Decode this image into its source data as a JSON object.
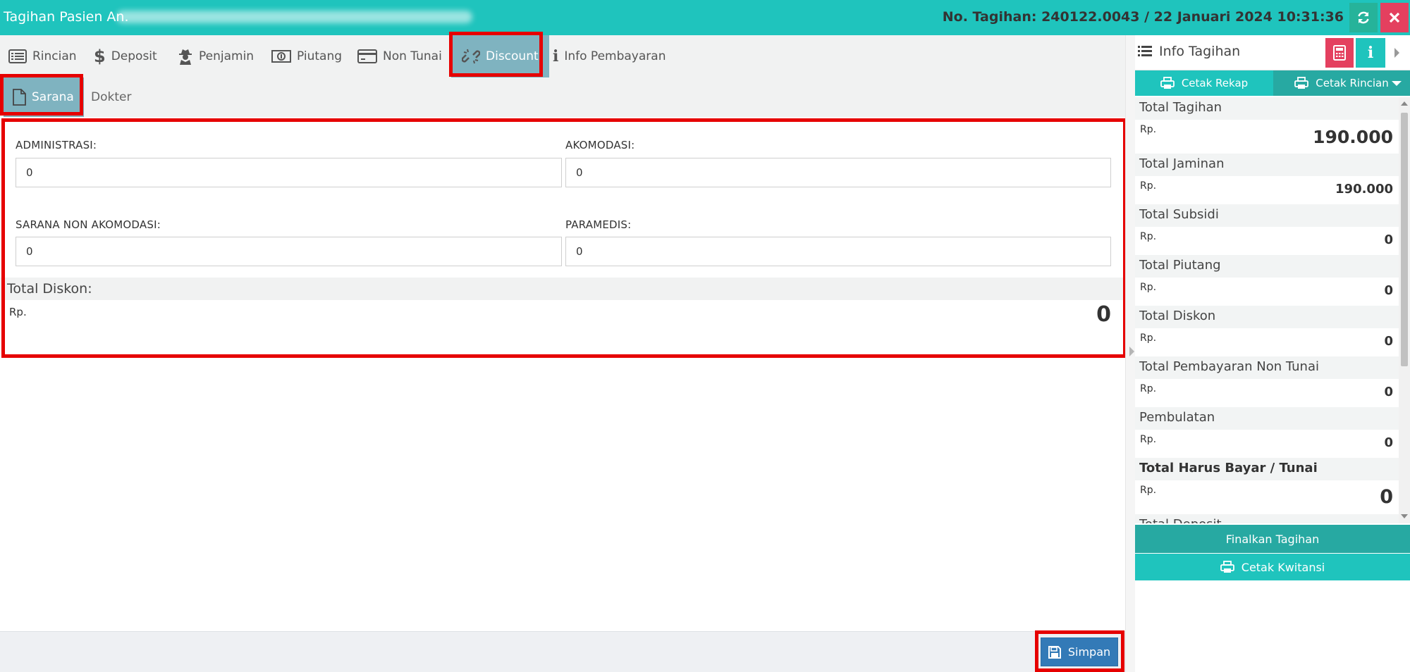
{
  "header": {
    "title": "Tagihan Pasien An.",
    "bill_info": "No. Tagihan: 240122.0043 / 22 Januari 2024 10:31:36"
  },
  "tabs": [
    {
      "label": "Rincian",
      "icon": "list-icon"
    },
    {
      "label": "Deposit",
      "icon": "dollar-icon"
    },
    {
      "label": "Penjamin",
      "icon": "user-secret-icon"
    },
    {
      "label": "Piutang",
      "icon": "money-icon"
    },
    {
      "label": "Non Tunai",
      "icon": "credit-card-icon"
    },
    {
      "label": "Discount",
      "icon": "unlink-icon",
      "active": true
    },
    {
      "label": "Info Pembayaran",
      "icon": "info-icon"
    }
  ],
  "subtabs": [
    {
      "label": "Sarana",
      "icon": "file-icon",
      "active": true
    },
    {
      "label": "Dokter"
    }
  ],
  "form": {
    "administrasi": {
      "label": "ADMINISTRASI:",
      "value": "0"
    },
    "akomodasi": {
      "label": "AKOMODASI:",
      "value": "0"
    },
    "sarana_non_akomodasi": {
      "label": "SARANA NON AKOMODASI:",
      "value": "0"
    },
    "paramedis": {
      "label": "PARAMEDIS:",
      "value": "0"
    },
    "total_diskon": {
      "label": "Total Diskon:",
      "currency": "Rp.",
      "value": "0"
    }
  },
  "footer": {
    "save_label": "Simpan"
  },
  "side": {
    "title": "Info Tagihan",
    "cetak_rekap": "Cetak Rekap",
    "cetak_rincian": "Cetak Rincian",
    "items": [
      {
        "label": "Total Tagihan",
        "currency": "Rp.",
        "value": "190.000"
      },
      {
        "label": "Total Jaminan",
        "currency": "Rp.",
        "value": "190.000"
      },
      {
        "label": "Total Subsidi",
        "currency": "Rp.",
        "value": "0"
      },
      {
        "label": "Total Piutang",
        "currency": "Rp.",
        "value": "0"
      },
      {
        "label": "Total Diskon",
        "currency": "Rp.",
        "value": "0"
      },
      {
        "label": "Total Pembayaran Non Tunai",
        "currency": "Rp.",
        "value": "0"
      },
      {
        "label": "Pembulatan",
        "currency": "Rp.",
        "value": "0"
      },
      {
        "label": "Total Harus Bayar / Tunai",
        "currency": "Rp.",
        "value": "0"
      },
      {
        "label": "Total Deposit"
      }
    ],
    "finalkan_label": "Finalkan Tagihan",
    "kwitansi_label": "Cetak Kwitansi"
  },
  "colors": {
    "header": "#1fc4bd",
    "active_tab": "#7fb3c0",
    "highlight": "#e60000",
    "primary_button": "#337ab7",
    "danger": "#e4405f",
    "teal_dark": "#27a9a2"
  }
}
